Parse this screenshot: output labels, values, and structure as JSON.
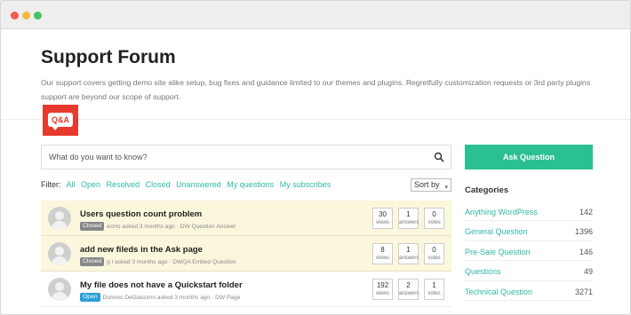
{
  "window": {
    "controls": [
      "close",
      "minimize",
      "maximize"
    ]
  },
  "header": {
    "title": "Support Forum",
    "description": "Our support covers getting demo site alike setup, bug fixes and guidance limited to our themes and plugins. Regretfully customization requests or 3rd party plugins support are beyond our scope of support.",
    "logo_text": "Q&A"
  },
  "search": {
    "placeholder": "What do you want to know?"
  },
  "filter": {
    "label": "Filter:",
    "links": [
      "All",
      "Open",
      "Resolved",
      "Closed",
      "Unanswered",
      "My questions",
      "My subscribes"
    ],
    "sort_label": "Sort by"
  },
  "questions": [
    {
      "title": "Users question count problem",
      "status": "Closed",
      "meta": "ecHo asked 3 months ago · DW Question Answer",
      "views": "30",
      "answers": "1",
      "votes": "0",
      "sticky": true
    },
    {
      "title": "add new fileds in the Ask page",
      "status": "Closed",
      "meta": "g l asked 3 months ago · DWQA Embed Question",
      "views": "8",
      "answers": "1",
      "votes": "0",
      "sticky": true
    },
    {
      "title": "My file does not have a Quickstart folder",
      "status": "Open",
      "meta": "Dolores DeGiacomo asked 3 months ago · DW Page",
      "views": "192",
      "answers": "2",
      "votes": "1",
      "sticky": false
    }
  ],
  "stat_labels": {
    "views": "views",
    "answers": "answers",
    "votes": "votes"
  },
  "sidebar": {
    "ask_button": "Ask Question",
    "categories_heading": "Categories",
    "categories": [
      {
        "name": "Anything WordPress",
        "count": "142"
      },
      {
        "name": "General Question",
        "count": "1396"
      },
      {
        "name": "Pre-Sale Question",
        "count": "146"
      },
      {
        "name": "Questions",
        "count": "49"
      },
      {
        "name": "Technical Question",
        "count": "3271"
      }
    ]
  },
  "colors": {
    "accent": "#2bbf94",
    "link": "#2fb9a5",
    "sticky_bg": "#fbf7dd",
    "logo": "#e63a2e",
    "badge_open": "#2b9fd8",
    "badge_closed": "#888888"
  }
}
